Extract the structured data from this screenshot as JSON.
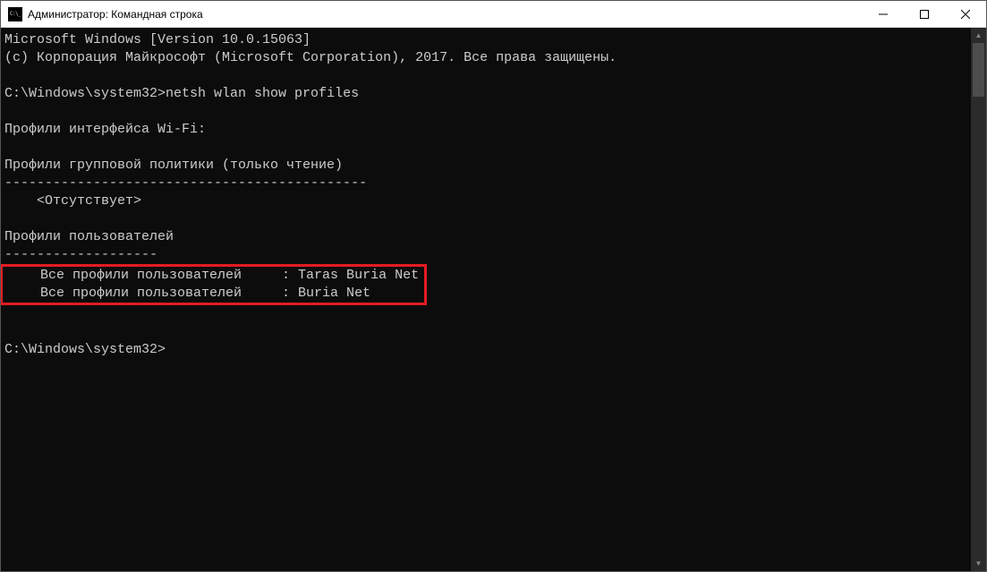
{
  "titlebar": {
    "title": "Администратор: Командная строка"
  },
  "console": {
    "version_line": "Microsoft Windows [Version 10.0.15063]",
    "copyright_line": "(c) Корпорация Майкрософт (Microsoft Corporation), 2017. Все права защищены.",
    "prompt1": "C:\\Windows\\system32>",
    "command": "netsh wlan show profiles",
    "header_interface": "Профили интерфейса Wi-Fi:",
    "group_policy_header": "Профили групповой политики (только чтение)",
    "group_policy_separator": "---------------------------------------------",
    "absent_label": "    <Отсутствует>",
    "user_profiles_header": "Профили пользователей",
    "user_profiles_separator": "-------------------",
    "profile_row1": "    Все профили пользователей     : Taras Buria Net",
    "profile_row2": "    Все профили пользователей     : Buria Net",
    "prompt2": "C:\\Windows\\system32>"
  }
}
